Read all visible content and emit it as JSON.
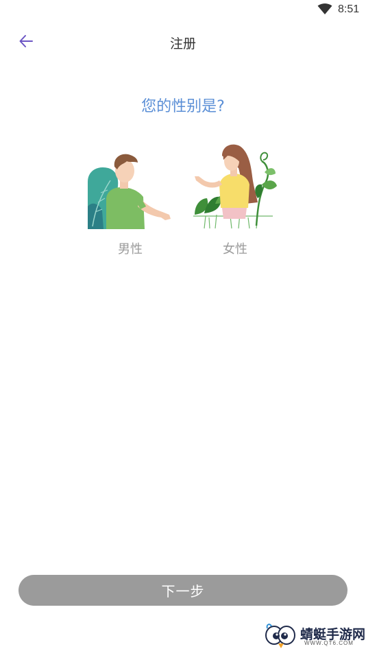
{
  "status_bar": {
    "time": "8:51",
    "wifi_icon": "wifi-icon"
  },
  "header": {
    "back_icon": "arrow-left-icon",
    "title": "注册"
  },
  "question": "您的性别是?",
  "gender_options": [
    {
      "label": "男性",
      "illustration": "male-illustration"
    },
    {
      "label": "女性",
      "illustration": "female-illustration"
    }
  ],
  "next_button": {
    "label": "下一步"
  },
  "watermark": {
    "name": "蜻蜓手游网",
    "url": "WWW.QT6.COM"
  },
  "colors": {
    "accent_question": "#5b8fd6",
    "back_arrow": "#6b55c4",
    "button_disabled": "#9b9b9b",
    "label_gray": "#9a9a9a"
  }
}
